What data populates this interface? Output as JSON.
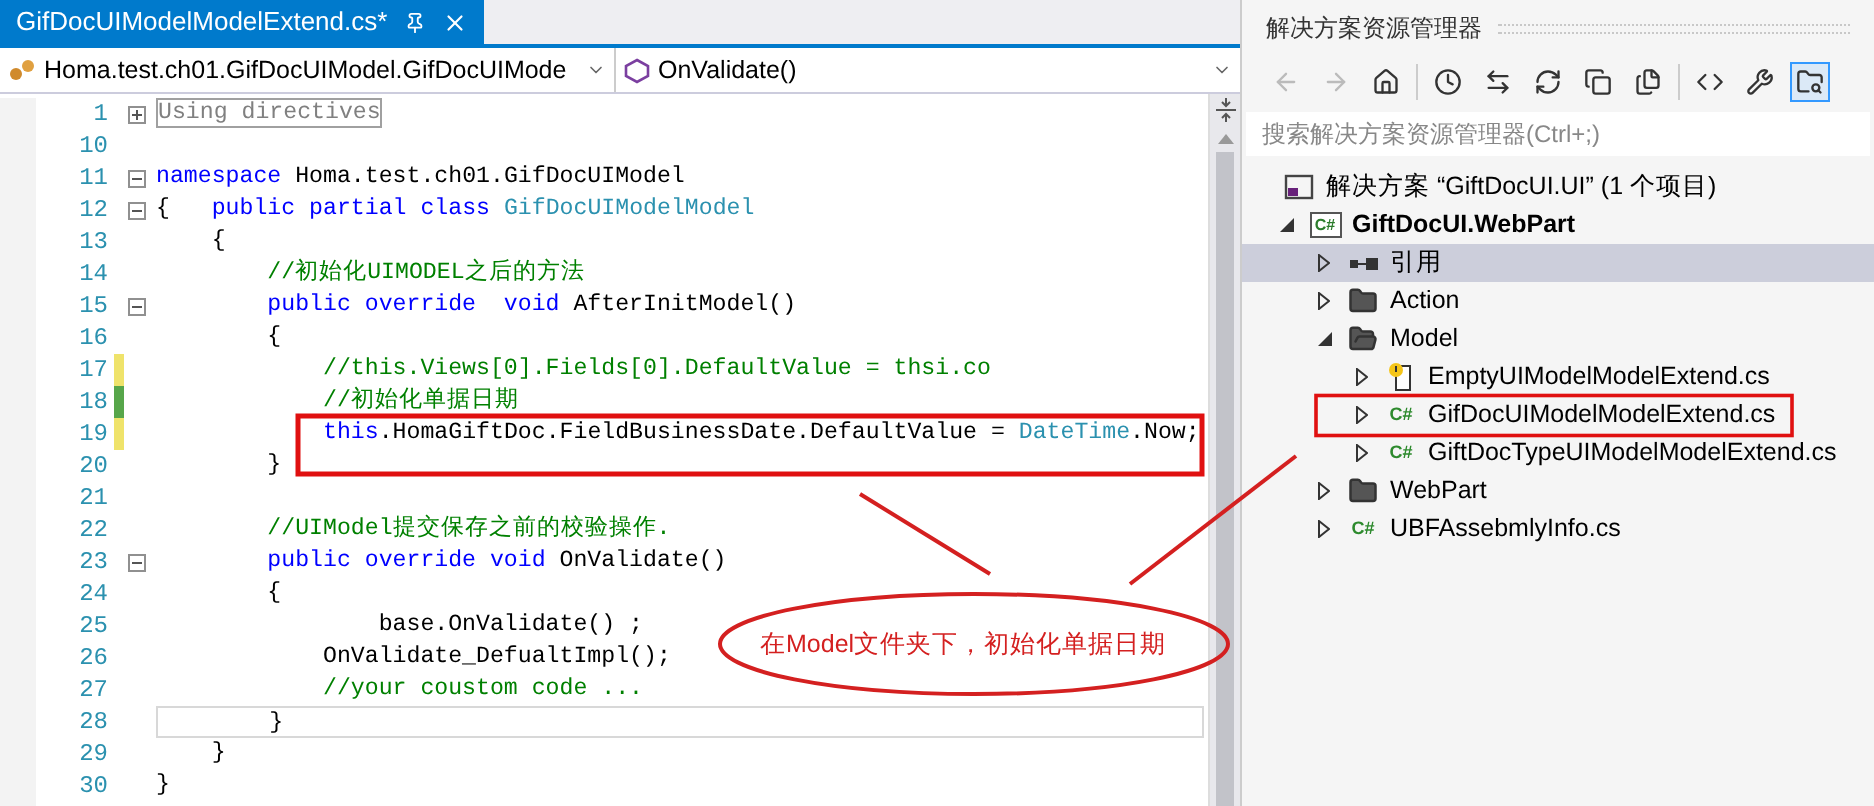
{
  "editor": {
    "tab": {
      "title": "GifDocUIModelModelExtend.cs*",
      "selected": true
    },
    "nav": {
      "type_dropdown": "Homa.test.ch01.GifDocUIModel.GifDocUIMode",
      "member_dropdown": "OnValidate()"
    },
    "lines": [
      {
        "number": "1",
        "collapsible": true,
        "collapsed": true,
        "tokens": [
          {
            "kind": "collapsed",
            "text": "Using directives"
          }
        ]
      },
      {
        "number": "10"
      },
      {
        "number": "11",
        "collapsible": true,
        "collapsed": false,
        "tokens": [
          {
            "kind": "keyword",
            "text": "namespace"
          },
          {
            "kind": "plain",
            "text": " Homa.test.ch01.GifDocUIModel"
          }
        ]
      },
      {
        "number": "12",
        "collapsible": true,
        "collapsed": false,
        "tokens": [
          {
            "kind": "plain",
            "text": "{   "
          },
          {
            "kind": "keyword",
            "text": "public partial class"
          },
          {
            "kind": "type",
            "text": " GifDocUIModelModel"
          }
        ]
      },
      {
        "number": "13",
        "tokens": [
          {
            "kind": "plain",
            "text": "    {"
          }
        ]
      },
      {
        "number": "14",
        "tokens": [
          {
            "kind": "comment",
            "text": "        //初始化UIMODEL之后的方法"
          }
        ]
      },
      {
        "number": "15",
        "collapsible": true,
        "collapsed": false,
        "tokens": [
          {
            "kind": "keyword",
            "text": "        public override  void"
          },
          {
            "kind": "plain",
            "text": " AfterInitModel()"
          }
        ]
      },
      {
        "number": "16",
        "tokens": [
          {
            "kind": "plain",
            "text": "        {"
          }
        ]
      },
      {
        "number": "17",
        "modified": true,
        "saved": false,
        "tokens": [
          {
            "kind": "comment",
            "text": "            //this.Views[0].Fields[0].DefaultValue = thsi.co"
          }
        ]
      },
      {
        "number": "18",
        "modified": true,
        "saved": true,
        "tokens": [
          {
            "kind": "comment",
            "text": "            //初始化单据日期"
          }
        ]
      },
      {
        "number": "19",
        "modified": true,
        "saved": false,
        "tokens": [
          {
            "kind": "keyword",
            "text": "            this"
          },
          {
            "kind": "plain",
            "text": ".HomaGiftDoc.FieldBusinessDate.DefaultValue = "
          },
          {
            "kind": "type",
            "text": "DateTime"
          },
          {
            "kind": "plain",
            "text": ".Now;"
          }
        ]
      },
      {
        "number": "20",
        "tokens": [
          {
            "kind": "plain",
            "text": "        }"
          }
        ]
      },
      {
        "number": "21"
      },
      {
        "number": "22",
        "tokens": [
          {
            "kind": "comment",
            "text": "        //UIModel提交保存之前的校验操作."
          }
        ]
      },
      {
        "number": "23",
        "collapsible": true,
        "collapsed": false,
        "tokens": [
          {
            "kind": "keyword",
            "text": "        public override void"
          },
          {
            "kind": "plain",
            "text": " OnValidate()"
          }
        ]
      },
      {
        "number": "24",
        "tokens": [
          {
            "kind": "plain",
            "text": "        {"
          }
        ]
      },
      {
        "number": "25",
        "tokens": [
          {
            "kind": "plain",
            "text": "                base.OnValidate() ;"
          }
        ]
      },
      {
        "number": "26",
        "tokens": [
          {
            "kind": "plain",
            "text": "            OnValidate_DefualtImpl();"
          }
        ]
      },
      {
        "number": "27",
        "tokens": [
          {
            "kind": "comment",
            "text": "            //your coustom code ..."
          }
        ]
      },
      {
        "number": "28",
        "current": true,
        "tokens": [
          {
            "kind": "plain",
            "text": "        }"
          }
        ]
      },
      {
        "number": "29",
        "tokens": [
          {
            "kind": "plain",
            "text": "    }"
          }
        ]
      },
      {
        "number": "30",
        "tokens": [
          {
            "kind": "plain",
            "text": "}"
          }
        ]
      }
    ]
  },
  "solution_explorer": {
    "title": "解决方案资源管理器",
    "toolbar": [
      {
        "disabled": true,
        "selected": false
      },
      {
        "disabled": true,
        "selected": false
      },
      {
        "disabled": false,
        "selected": false
      },
      {
        "disabled": false,
        "selected": false
      },
      {
        "disabled": false,
        "selected": false
      },
      {
        "disabled": false,
        "selected": false
      },
      {
        "disabled": false,
        "selected": false
      },
      {
        "disabled": false,
        "selected": false
      },
      {
        "disabled": false,
        "selected": false
      },
      {
        "disabled": false,
        "selected": false
      },
      {
        "disabled": false,
        "selected": true
      }
    ],
    "search": {
      "placeholder": "搜索解决方案资源管理器(Ctrl+;)"
    },
    "tree": [
      {
        "kind": "solution",
        "label": "解决方案 “GiftDocUI.UI” (1 个项目)",
        "selected": false,
        "children": [
          {
            "kind": "project",
            "icon_label": "C#",
            "label": "GiftDocUI.WebPart",
            "expanded": true,
            "selected": false,
            "children": [
              {
                "kind": "references",
                "label": "引用",
                "expanded": false,
                "selected": true
              },
              {
                "kind": "folder",
                "label": "Action",
                "expanded": false,
                "selected": false
              },
              {
                "kind": "folder",
                "label": "Model",
                "expanded": true,
                "selected": false,
                "children": [
                  {
                    "kind": "pending-file",
                    "label": "EmptyUIModelModelExtend.cs",
                    "expanded": false,
                    "selected": false
                  },
                  {
                    "kind": "cs-file",
                    "icon_label": "C#",
                    "label": "GifDocUIModelModelExtend.cs",
                    "expanded": false,
                    "selected": false
                  },
                  {
                    "kind": "cs-file",
                    "icon_label": "C#",
                    "label": "GiftDocTypeUIModelModelExtend.cs",
                    "expanded": false,
                    "selected": false
                  }
                ]
              },
              {
                "kind": "folder",
                "label": "WebPart",
                "expanded": false,
                "selected": false
              },
              {
                "kind": "cs-file",
                "icon_label": "C#",
                "label": "UBFAssebmlyInfo.cs",
                "expanded": false,
                "selected": false
              }
            ]
          }
        ]
      }
    ]
  },
  "annotation": {
    "text": "在Model文件夹下，初始化单据日期"
  }
}
